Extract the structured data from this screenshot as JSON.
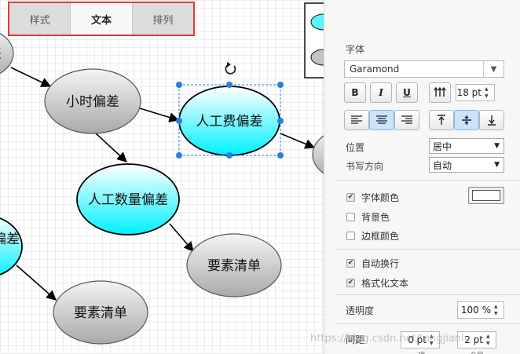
{
  "canvas": {
    "nodes": [
      {
        "id": "n0",
        "label": "差"
      },
      {
        "id": "n1",
        "label": "小时偏差"
      },
      {
        "id": "n2",
        "label": "人工费偏差"
      },
      {
        "id": "n3",
        "label": "人工数量偏差"
      },
      {
        "id": "n4",
        "label": "偏差"
      },
      {
        "id": "n5",
        "label": "要素清单"
      },
      {
        "id": "n6",
        "label": "要素清单"
      }
    ],
    "colors": {
      "cyan_fill": "#00f0ff",
      "gray_fill": "#b5b5b5",
      "selection": "#2a7de1"
    }
  },
  "panel": {
    "tabs": [
      {
        "label": "样式",
        "active": false
      },
      {
        "label": "文本",
        "active": true
      },
      {
        "label": "排列",
        "active": false
      }
    ],
    "font": {
      "section_label": "字体",
      "family_value": "Garamond",
      "bold_label": "B",
      "italic_label": "I",
      "underline_label": "U",
      "size_value": "18 pt"
    },
    "position": {
      "label": "位置",
      "value": "居中"
    },
    "writing_direction": {
      "label": "书写方向",
      "value": "自动"
    },
    "font_color": {
      "label": "字体颜色",
      "checked": true,
      "value": "#ffffff"
    },
    "background_color": {
      "label": "背景色",
      "checked": false
    },
    "border_color": {
      "label": "边框颜色",
      "checked": false
    },
    "auto_wrap": {
      "label": "自动换行",
      "checked": true
    },
    "formatted_text": {
      "label": "格式化文本",
      "checked": true
    },
    "opacity": {
      "label": "透明度",
      "value": "100 %"
    },
    "spacing": {
      "label": "间距",
      "top_value": "0 pt",
      "global_value": "2 pt",
      "top_sublabel": "顶",
      "global_sublabel": "全局"
    },
    "accent_color": "#e53935"
  },
  "watermark": "https://blog.csdn.net/tongjianlu"
}
